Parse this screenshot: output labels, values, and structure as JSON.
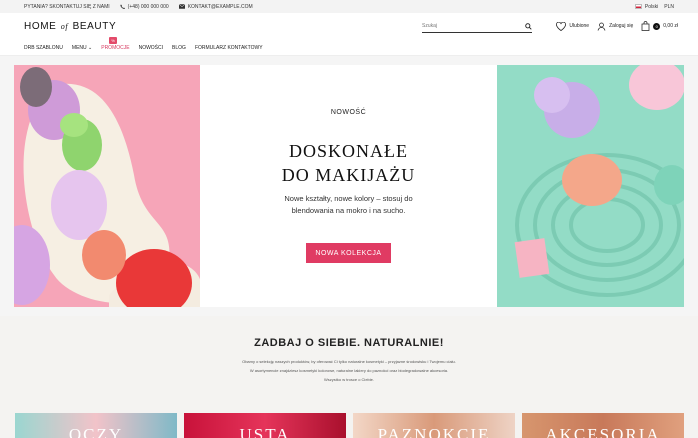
{
  "topbar": {
    "question": "PYTANIA? SKONTAKTUJ SIĘ Z NAMI",
    "phone": "(+48) 000 000 000",
    "email": "KONTAKT@EXAMPLE.COM",
    "language": "Polski",
    "currency": "PLN"
  },
  "header": {
    "logo_part1": "HOME",
    "logo_of": "of",
    "logo_part2": "BEAUTY",
    "search_placeholder": "Szukaj",
    "favorites": "Ulubione",
    "login": "Zaloguj się",
    "cart_count": "0",
    "cart_total": "0,00 zł"
  },
  "nav": {
    "items": [
      "DRB SZABLONU",
      "MENU",
      "PROMOCJE",
      "NOWOŚCI",
      "BLOG",
      "FORMULARZ KONTAKTOWY"
    ],
    "promo_tag": "%"
  },
  "hero": {
    "kicker": "NOWOŚĆ",
    "title_line1": "DOSKONAŁE",
    "title_line2": "DO MAKIJAŻU",
    "subtitle": "Nowe kształty, nowe kolory – stosuj do blendowania na mokro i na sucho.",
    "button": "NOWA KOLEKCJA"
  },
  "about": {
    "title": "ZADBAJ O SIEBIE. NATURALNIE!",
    "line1": "Obamy o selekcję naszych produktów, by oferować Ci tylko naturalne kosmetyki – przyjazne środowisku i Twojemu ciału.",
    "line2": "W asortymencie znajdziesz kosmetyki kolorowe, naturalne lakiery do paznokci oraz biodegradowalne akcesoria.",
    "line3": "Wszystko w trosce o Ciebie."
  },
  "categories": [
    "OCZY",
    "USTA",
    "PAZNOKCIE",
    "AKCESORIA"
  ],
  "colors": {
    "accent": "#e03b63",
    "hero_left_bg": "#f7a3b6",
    "hero_right_bg": "#8fd9c3"
  }
}
